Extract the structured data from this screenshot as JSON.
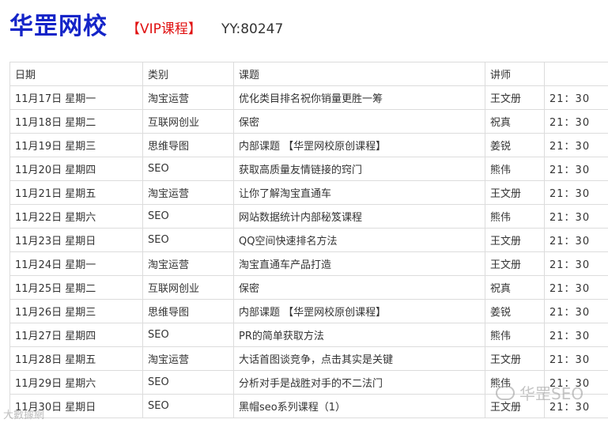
{
  "header": {
    "logo": "华罡网校",
    "vip": "【VIP课程】",
    "yy": "YY:80247"
  },
  "table": {
    "columns": [
      "日期",
      "类别",
      "课题",
      "讲师",
      ""
    ],
    "rows": [
      {
        "date": "11月17日 星期一",
        "category": "淘宝运营",
        "topic": "优化类目排名祝你销量更胜一筹",
        "lecturer": "王文册",
        "time": "21：30"
      },
      {
        "date": "11月18日 星期二",
        "category": "互联网创业",
        "topic": "保密",
        "lecturer": "祝真",
        "time": "21：30"
      },
      {
        "date": "11月19日 星期三",
        "category": "思维导图",
        "topic": "内部课题 【华罡网校原创课程】",
        "lecturer": "姜锐",
        "time": "21：30"
      },
      {
        "date": "11月20日 星期四",
        "category": "SEO",
        "topic": "获取高质量友情链接的窍门",
        "lecturer": "熊伟",
        "time": "21：30"
      },
      {
        "date": "11月21日 星期五",
        "category": "淘宝运营",
        "topic": "让你了解淘宝直通车",
        "lecturer": "王文册",
        "time": "21：30"
      },
      {
        "date": "11月22日 星期六",
        "category": "SEO",
        "topic": "网站数据统计内部秘笈课程",
        "lecturer": "熊伟",
        "time": "21：30"
      },
      {
        "date": "11月23日 星期日",
        "category": "SEO",
        "topic": "QQ空间快速排名方法",
        "lecturer": "王文册",
        "time": "21：30"
      },
      {
        "date": "11月24日 星期一",
        "category": "淘宝运营",
        "topic": "淘宝直通车产品打造",
        "lecturer": "王文册",
        "time": "21：30"
      },
      {
        "date": "11月25日 星期二",
        "category": "互联网创业",
        "topic": "保密",
        "lecturer": "祝真",
        "time": "21：30"
      },
      {
        "date": "11月26日 星期三",
        "category": "思维导图",
        "topic": "内部课题 【华罡网校原创课程】",
        "lecturer": "姜锐",
        "time": "21：30"
      },
      {
        "date": "11月27日 星期四",
        "category": "SEO",
        "topic": "PR的简单获取方法",
        "lecturer": "熊伟",
        "time": "21：30"
      },
      {
        "date": "11月28日 星期五",
        "category": "淘宝运营",
        "topic": "大话首图谈竞争，点击其实是关键",
        "lecturer": "王文册",
        "time": "21：30"
      },
      {
        "date": "11月29日 星期六",
        "category": "SEO",
        "topic": "分析对手是战胜对手的不二法门",
        "lecturer": "熊伟",
        "time": "21：30"
      },
      {
        "date": "11月30日 星期日",
        "category": "SEO",
        "topic": "黑帽seo系列课程（1）",
        "lecturer": "王文册",
        "time": "21：30"
      }
    ]
  },
  "watermark": {
    "text": "华罡SEO",
    "bottom_text": "大數據網"
  }
}
